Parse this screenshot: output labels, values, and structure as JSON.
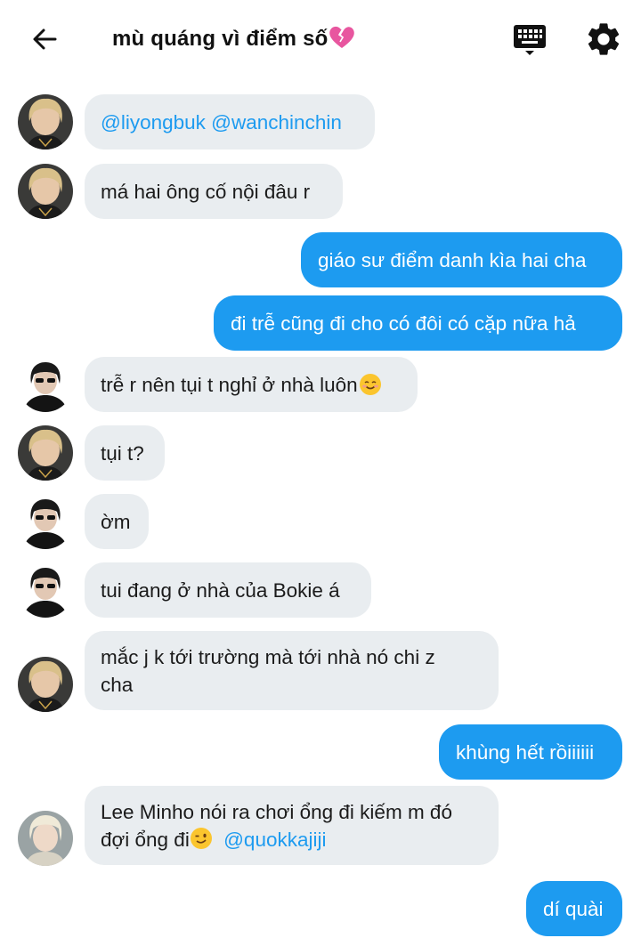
{
  "header": {
    "title": "mù quáng vì điểm số",
    "title_emoji": "broken-heart",
    "back_icon": "back-arrow-icon",
    "keyboard_icon": "keyboard-icon",
    "settings_icon": "gear-icon"
  },
  "colors": {
    "outgoing_bubble": "#1d9bf0",
    "incoming_bubble": "#e9edf0",
    "mention": "#1d9bf0"
  },
  "messages": [
    {
      "direction": "in",
      "avatar": "user-a",
      "parts": [
        {
          "mention": "@liyongbuk"
        },
        {
          "text": " "
        },
        {
          "mention": "@wanchinchin"
        }
      ]
    },
    {
      "direction": "in",
      "avatar": "user-a",
      "text": "má hai ông cố nội đâu r"
    },
    {
      "direction": "out",
      "text": "giáo sư điểm danh kìa hai cha"
    },
    {
      "direction": "out",
      "text": "đi trễ cũng đi cho có đôi có cặp nữa hả"
    },
    {
      "direction": "in",
      "avatar": "user-b",
      "text": "trễ r nên tụi t nghỉ ở nhà luôn",
      "emoji": "smiling-face"
    },
    {
      "direction": "in",
      "avatar": "user-a",
      "text": "tụi t?"
    },
    {
      "direction": "in",
      "avatar": "user-b",
      "text": "ờm"
    },
    {
      "direction": "in",
      "avatar": "user-b",
      "text": "tui đang ở nhà của Bokie á"
    },
    {
      "direction": "in",
      "avatar": "user-a",
      "line1": "mắc j k tới trường mà tới nhà nó chi z",
      "line2": "cha"
    },
    {
      "direction": "out",
      "text": "khùng hết rồiiiiii"
    },
    {
      "direction": "in",
      "avatar": "user-c",
      "line1": "Lee Minho nói ra chơi ổng đi kiếm m đó",
      "line2": "đợi ổng đi",
      "emoji": "winking-face",
      "mention": "@quokkajiji"
    },
    {
      "direction": "out",
      "text": "dí quài"
    }
  ]
}
